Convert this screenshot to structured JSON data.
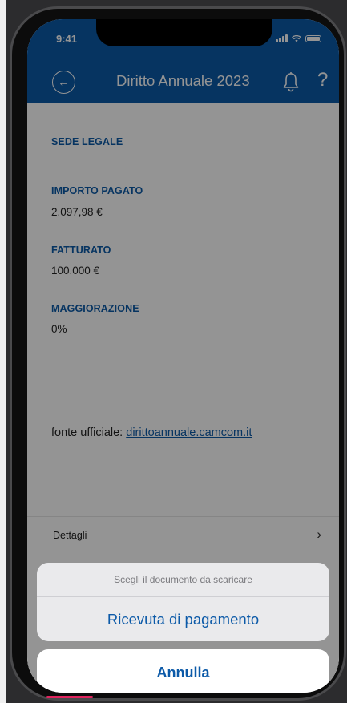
{
  "status_bar": {
    "time": "9:41"
  },
  "header": {
    "title": "Diritto Annuale 2023",
    "back_icon": "arrow-left-circle-icon",
    "bell_icon": "bell-icon",
    "help_label": "?"
  },
  "fields": [
    {
      "label": "SEDE LEGALE",
      "value": ""
    },
    {
      "label": "IMPORTO PAGATO",
      "value": "2.097,98 €"
    },
    {
      "label": "FATTURATO",
      "value": "100.000 €"
    },
    {
      "label": "MAGGIORAZIONE",
      "value": "0%"
    }
  ],
  "source": {
    "prefix": "fonte ufficiale: ",
    "link_text": "dirittoannuale.camcom.it"
  },
  "details": {
    "label": "Dettagli",
    "chevron": "›"
  },
  "action_sheet": {
    "title": "Scegli il documento da scaricare",
    "option": "Ricevuta di pagamento",
    "cancel": "Annulla"
  },
  "colors": {
    "brand_blue": "#0c5aa8",
    "overlay": "rgba(0,0,0,0.42)"
  }
}
